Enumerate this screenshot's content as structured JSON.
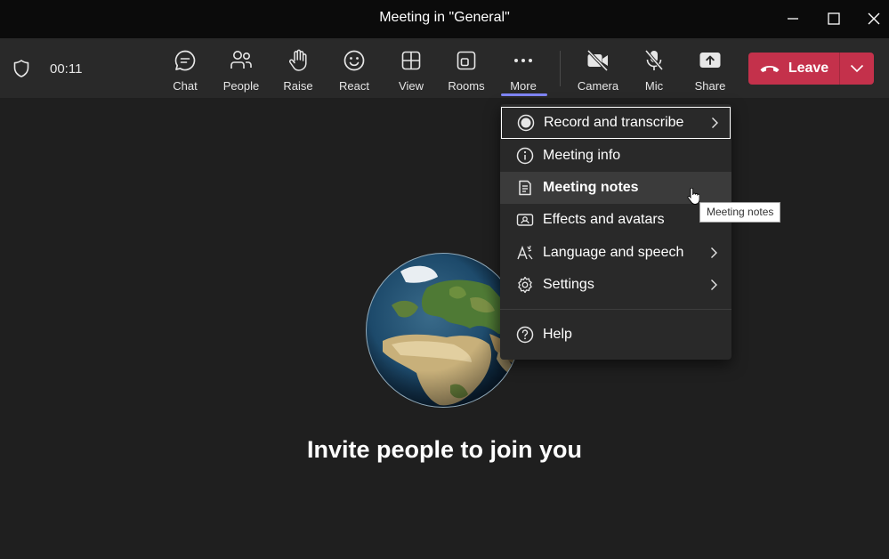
{
  "window": {
    "title": "Meeting in \"General\"",
    "controls": [
      "minimize-icon",
      "maximize-icon",
      "close-icon"
    ]
  },
  "toolbar": {
    "timer": "00:11",
    "buttons": [
      {
        "label": "Chat",
        "icon": "chat-icon"
      },
      {
        "label": "People",
        "icon": "people-icon"
      },
      {
        "label": "Raise",
        "icon": "raise-hand-icon"
      },
      {
        "label": "React",
        "icon": "react-smiley-icon"
      },
      {
        "label": "View",
        "icon": "view-grid-icon"
      },
      {
        "label": "Rooms",
        "icon": "rooms-icon"
      },
      {
        "label": "More",
        "icon": "more-ellipsis-icon"
      },
      {
        "label": "Camera",
        "icon": "camera-off-icon"
      },
      {
        "label": "Mic",
        "icon": "mic-off-icon"
      },
      {
        "label": "Share",
        "icon": "share-icon"
      }
    ],
    "leave_label": "Leave"
  },
  "menu": {
    "items": [
      {
        "label": "Record and transcribe",
        "icon": "record-icon",
        "submenu": true
      },
      {
        "label": "Meeting info",
        "icon": "info-icon",
        "submenu": false
      },
      {
        "label": "Meeting notes",
        "icon": "notes-icon",
        "submenu": false
      },
      {
        "label": "Effects and avatars",
        "icon": "effects-icon",
        "submenu": false
      },
      {
        "label": "Language and speech",
        "icon": "language-icon",
        "submenu": true
      },
      {
        "label": "Settings",
        "icon": "gear-icon",
        "submenu": true
      },
      {
        "label": "Help",
        "icon": "help-icon",
        "submenu": false
      }
    ]
  },
  "tooltip": "Meeting notes",
  "main": {
    "invite_text": "Invite people to join you"
  },
  "colors": {
    "background": "#1f1f1f",
    "toolbar": "#292929",
    "titlebar": "#0b0b0b",
    "leave": "#c4314b",
    "accent": "#7f85f5"
  }
}
